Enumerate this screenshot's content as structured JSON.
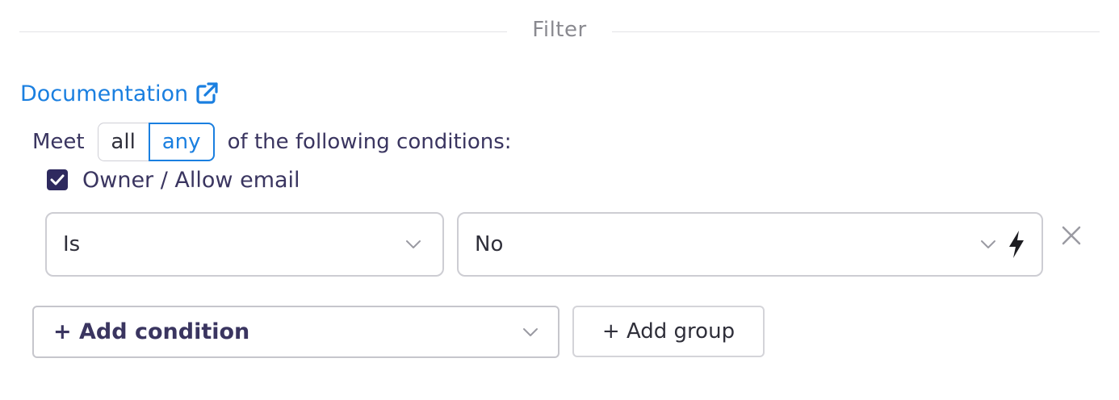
{
  "section": {
    "title": "Filter"
  },
  "documentation": {
    "label": "Documentation",
    "icon": "external-link-icon",
    "color": "#1a7fe0"
  },
  "match": {
    "prefix": "Meet",
    "options": [
      "all",
      "any"
    ],
    "selected": "any",
    "suffix": "of the following conditions:"
  },
  "condition": {
    "checked": true,
    "field_label": "Owner / Allow email",
    "operator": "Is",
    "value": "No",
    "value_icon": "lightning-bolt-icon",
    "remove_icon": "close-icon"
  },
  "actions": {
    "add_condition": "+ Add condition",
    "add_group": "+ Add group"
  },
  "colors": {
    "accent": "#1a7fe0",
    "checkbox": "#2e2a5e",
    "text": "#3a3560"
  }
}
